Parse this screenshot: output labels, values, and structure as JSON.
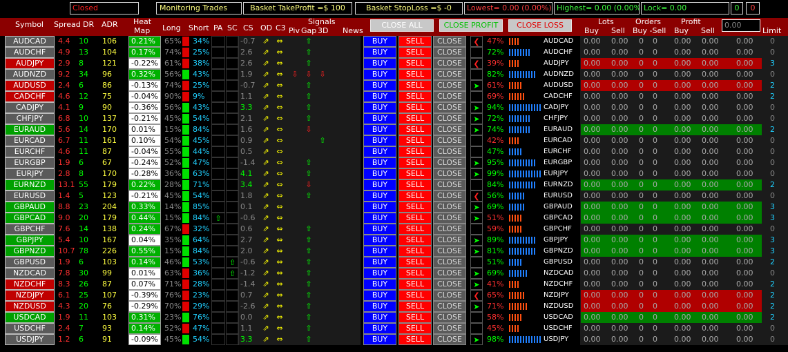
{
  "topbar": {
    "status": "Closed",
    "monitoring": "Monitoring Trades",
    "basket_tp": "Basket TakeProfit =$ 100",
    "basket_sl": "Basket StopLoss =$ -0",
    "lowest": "Lowest= 0.00 (0.00%)",
    "highest": "Highest= 0.00 (0.00%)",
    "lock": "Lock= 0.00",
    "c1": "0",
    "c2": "0"
  },
  "header": {
    "symbol": "Symbol",
    "spread": "Spread",
    "dr": "DR",
    "adr": "ADR",
    "heat": "Heat",
    "map": "Map",
    "long": "Long",
    "short": "Short",
    "pa": "PA",
    "sc": "SC",
    "cs": "CS",
    "od": "OD",
    "c3": "C3",
    "signals": "Signals",
    "piv": "Piv",
    "gap": "Gap",
    "three_d": "3D",
    "news": "News",
    "close_all": "CLOSE ALL",
    "close_profit": "CLOSE PROFIT",
    "close_loss": "CLOSE LOSS",
    "lots": "Lots",
    "orders": "Orders",
    "profit": "Profit",
    "buy": "Buy",
    "sell": "Sell",
    "buy_sell": "Buy -Sell",
    "input_value": "0.00",
    "limit": "Limit"
  },
  "labels": {
    "buy": "BUY",
    "sell": "SELL",
    "close": "CLOSE"
  },
  "colors": {
    "green": "#00a000",
    "red": "#c00000",
    "grey": "#5a5a5a",
    "blue": "#0000ff"
  },
  "rows": [
    {
      "sym": "AUDCAD",
      "bg": "grey",
      "sp": "4.4",
      "dr": "10",
      "adr": "106",
      "heat": "0.21%",
      "hp": true,
      "long": "65%",
      "short": "34%",
      "lc": "r",
      "cs": "-0.7",
      "csc": "grey",
      "sig": [
        1,
        2,
        0,
        3,
        0
      ],
      "sigc": 1,
      "pct": "47%",
      "pctc": "r",
      "pair": "AUDCAD",
      "lim": "0",
      "lc2": "grey",
      "arrow": "<",
      "arrc": "r",
      "bars": [
        0,
        0,
        0,
        0
      ],
      "rbg": ""
    },
    {
      "sym": "AUDCHF",
      "bg": "grey",
      "sp": "4.9",
      "dr": "13",
      "adr": "104",
      "heat": "0.17%",
      "hp": true,
      "long": "74%",
      "short": "25%",
      "lc": "r",
      "cs": "2.6",
      "csc": "grey",
      "sig": [
        1,
        2,
        0,
        3,
        0
      ],
      "pct": "72%",
      "pctc": "g",
      "pair": "AUDCHF",
      "lim": "0",
      "lc2": "grey",
      "arrow": "",
      "bars": [
        1,
        1,
        1,
        1,
        1,
        1,
        1,
        1
      ],
      "rbg": ""
    },
    {
      "sym": "AUDJPY",
      "bg": "red",
      "sp": "2.9",
      "dr": "8",
      "adr": "121",
      "heat": "-0.22%",
      "hp": false,
      "long": "61%",
      "short": "38%",
      "lc": "r",
      "cs": "2.6",
      "csc": "grey",
      "sig": [
        1,
        2,
        0,
        3,
        0
      ],
      "pct": "39%",
      "pctc": "r",
      "pair": "AUDJPY",
      "lim": "3",
      "lc2": "c",
      "arrow": "<",
      "arrc": "r",
      "bars": [
        0,
        0,
        0,
        0
      ],
      "rbg": "red"
    },
    {
      "sym": "AUDNZD",
      "bg": "grey",
      "sp": "9.2",
      "dr": "34",
      "adr": "96",
      "heat": "0.32%",
      "hp": true,
      "long": "56%",
      "short": "43%",
      "lc": "g",
      "cs": "1.9",
      "csc": "grey",
      "sig": [
        1,
        2,
        4,
        4,
        4
      ],
      "pct": "82%",
      "pctc": "g",
      "pair": "AUDNZD",
      "lim": "0",
      "lc2": "grey",
      "arrow": "",
      "bars": [
        1,
        1,
        1,
        1,
        1,
        1,
        1,
        1,
        1,
        1
      ],
      "rbg": ""
    },
    {
      "sym": "AUDUSD",
      "bg": "red",
      "sp": "2.4",
      "dr": "6",
      "adr": "86",
      "heat": "-0.13%",
      "hp": false,
      "long": "74%",
      "short": "25%",
      "lc": "r",
      "cs": "-0.7",
      "csc": "grey",
      "sig": [
        1,
        2,
        0,
        3,
        0
      ],
      "pct": "61%",
      "pctc": "r",
      "pair": "AUDUSD",
      "lim": "2",
      "lc2": "c",
      "arrow": ">",
      "arrc": "g",
      "bars": [
        0,
        0,
        0,
        0,
        0
      ],
      "rbg": "red"
    },
    {
      "sym": "CADCHF",
      "bg": "red",
      "sp": "4.6",
      "dr": "12",
      "adr": "75",
      "heat": "-0.04%",
      "hp": false,
      "long": "90%",
      "short": "9%",
      "lc": "r",
      "cs": "1.1",
      "csc": "grey",
      "sig": [
        1,
        2,
        0,
        3,
        0
      ],
      "pct": "69%",
      "pctc": "r",
      "pair": "CADCHF",
      "lim": "2",
      "lc2": "c",
      "arrow": "",
      "bars": [
        0,
        0,
        0,
        0,
        0,
        0
      ],
      "rbg": ""
    },
    {
      "sym": "CADJPY",
      "bg": "grey",
      "sp": "4.1",
      "dr": "9",
      "adr": "90",
      "heat": "-0.36%",
      "hp": false,
      "long": "56%",
      "short": "43%",
      "lc": "g",
      "cs": "3.3",
      "csc": "g",
      "sig": [
        1,
        2,
        0,
        3,
        0
      ],
      "pct": "94%",
      "pctc": "g",
      "pair": "CADJPY",
      "lim": "0",
      "lc2": "grey",
      "arrow": ">",
      "arrc": "g",
      "bars": [
        1,
        1,
        1,
        1,
        1,
        1,
        1,
        1,
        1,
        1,
        1,
        1
      ],
      "rbg": ""
    },
    {
      "sym": "CHFJPY",
      "bg": "grey",
      "sp": "6.8",
      "dr": "10",
      "adr": "137",
      "heat": "-0.21%",
      "hp": false,
      "long": "45%",
      "short": "54%",
      "lc": "g",
      "cs": "2.1",
      "csc": "grey",
      "sig": [
        1,
        2,
        0,
        3,
        0
      ],
      "pct": "72%",
      "pctc": "g",
      "pair": "CHFJPY",
      "lim": "0",
      "lc2": "grey",
      "arrow": ">",
      "arrc": "g",
      "bars": [
        1,
        1,
        1,
        1,
        1,
        1,
        1,
        1
      ],
      "rbg": ""
    },
    {
      "sym": "EURAUD",
      "bg": "green",
      "sp": "5.6",
      "dr": "14",
      "adr": "170",
      "heat": "0.01%",
      "hp": false,
      "long": "15%",
      "short": "84%",
      "lc": "g",
      "cs": "1.6",
      "csc": "grey",
      "sig": [
        1,
        2,
        0,
        4,
        0
      ],
      "pct": "74%",
      "pctc": "g",
      "pair": "EURAUD",
      "lim": "2",
      "lc2": "c",
      "arrow": ">",
      "arrc": "g",
      "bars": [
        1,
        1,
        1,
        1,
        1,
        1,
        1,
        1
      ],
      "rbg": "green"
    },
    {
      "sym": "EURCAD",
      "bg": "grey",
      "sp": "6.7",
      "dr": "11",
      "adr": "161",
      "heat": "0.10%",
      "hp": false,
      "long": "54%",
      "short": "45%",
      "lc": "g",
      "cs": "0.9",
      "csc": "grey",
      "sig": [
        1,
        2,
        0,
        0,
        3
      ],
      "pct": "42%",
      "pctc": "r",
      "pair": "EURCAD",
      "lim": "0",
      "lc2": "grey",
      "arrow": "",
      "bars": [
        0,
        0,
        0,
        0
      ],
      "rbg": ""
    },
    {
      "sym": "EURCHF",
      "bg": "grey",
      "sp": "4.6",
      "dr": "11",
      "adr": "87",
      "heat": "-0.04%",
      "hp": false,
      "long": "55%",
      "short": "44%",
      "lc": "g",
      "cs": "0.5",
      "csc": "grey",
      "sig": [
        1,
        2,
        0,
        0,
        0
      ],
      "pct": "47%",
      "pctc": "g",
      "pair": "EURCHF",
      "lim": "0",
      "lc2": "grey",
      "arrow": "",
      "bars": [
        1,
        1,
        1,
        1,
        1
      ],
      "rbg": ""
    },
    {
      "sym": "EURGBP",
      "bg": "grey",
      "sp": "1.9",
      "dr": "6",
      "adr": "67",
      "heat": "-0.24%",
      "hp": false,
      "long": "52%",
      "short": "47%",
      "lc": "g",
      "cs": "-1.4",
      "csc": "grey",
      "sig": [
        1,
        2,
        0,
        3,
        0
      ],
      "pct": "95%",
      "pctc": "g",
      "pair": "EURGBP",
      "lim": "0",
      "lc2": "grey",
      "arrow": ">",
      "arrc": "g",
      "bars": [
        1,
        1,
        1,
        1,
        1,
        1,
        1,
        1,
        1,
        1
      ],
      "rbg": ""
    },
    {
      "sym": "EURJPY",
      "bg": "grey",
      "sp": "2.8",
      "dr": "8",
      "adr": "170",
      "heat": "-0.28%",
      "hp": false,
      "long": "36%",
      "short": "63%",
      "lc": "g",
      "cs": "4.1",
      "csc": "g",
      "sig": [
        1,
        2,
        0,
        3,
        0
      ],
      "pct": "99%",
      "pctc": "g",
      "pair": "EURJPY",
      "lim": "0",
      "lc2": "grey",
      "arrow": ">",
      "arrc": "g",
      "bars": [
        1,
        1,
        1,
        1,
        1,
        1,
        1,
        1,
        1,
        1,
        1,
        1,
        1
      ],
      "rbg": ""
    },
    {
      "sym": "EURNZD",
      "bg": "green",
      "sp": "13.1",
      "dr": "55",
      "adr": "179",
      "heat": "0.22%",
      "hp": true,
      "long": "28%",
      "short": "71%",
      "lc": "g",
      "cs": "3.4",
      "csc": "g",
      "sig": [
        1,
        2,
        0,
        4,
        0
      ],
      "pct": "84%",
      "pctc": "g",
      "pair": "EURNZD",
      "lim": "2",
      "lc2": "c",
      "arrow": "",
      "bars": [
        1,
        1,
        1,
        1,
        1,
        1,
        1,
        1,
        1,
        1
      ],
      "rbg": "green"
    },
    {
      "sym": "EURUSD",
      "bg": "grey",
      "sp": "1.4",
      "dr": "5",
      "adr": "123",
      "heat": "-0.21%",
      "hp": false,
      "long": "45%",
      "short": "54%",
      "lc": "g",
      "cs": "1.8",
      "csc": "grey",
      "sig": [
        1,
        2,
        0,
        3,
        0
      ],
      "pct": "56%",
      "pctc": "g",
      "pair": "EURUSD",
      "lim": "0",
      "lc2": "grey",
      "arrow": "<",
      "arrc": "r",
      "bars": [
        1,
        1,
        1,
        1,
        1,
        1
      ],
      "rbg": ""
    },
    {
      "sym": "GBPAUD",
      "bg": "green",
      "sp": "8.8",
      "dr": "23",
      "adr": "204",
      "heat": "0.33%",
      "hp": true,
      "long": "14%",
      "short": "85%",
      "lc": "g",
      "cs": "0.1",
      "csc": "grey",
      "sig": [
        1,
        2,
        0,
        0,
        0
      ],
      "pct": "69%",
      "pctc": "g",
      "pair": "GBPAUD",
      "lim": "3",
      "lc2": "c",
      "arrow": ">",
      "arrc": "g",
      "bars": [
        1,
        1,
        1,
        1,
        1,
        1
      ],
      "rbg": "green"
    },
    {
      "sym": "GBPCAD",
      "bg": "green",
      "sp": "9.0",
      "dr": "20",
      "adr": "179",
      "heat": "0.44%",
      "hp": true,
      "long": "15%",
      "short": "84%",
      "lc": "g",
      "cs": "-0.6",
      "csc": "grey",
      "sig": [
        1,
        2,
        0,
        0,
        0
      ],
      "pa": true,
      "pct": "51%",
      "pctc": "r",
      "pair": "GBPCAD",
      "lim": "3",
      "lc2": "c",
      "arrow": ">",
      "arrc": "g",
      "bars": [
        0,
        0,
        0,
        0,
        0
      ],
      "rbg": "green"
    },
    {
      "sym": "GBPCHF",
      "bg": "grey",
      "sp": "7.6",
      "dr": "14",
      "adr": "138",
      "heat": "0.24%",
      "hp": true,
      "long": "67%",
      "short": "32%",
      "lc": "r",
      "cs": "0.6",
      "csc": "grey",
      "sig": [
        1,
        2,
        0,
        3,
        0
      ],
      "pct": "59%",
      "pctc": "r",
      "pair": "GBPCHF",
      "lim": "0",
      "lc2": "grey",
      "arrow": "",
      "bars": [
        0,
        0,
        0,
        0,
        0
      ],
      "rbg": ""
    },
    {
      "sym": "GBPJPY",
      "bg": "green",
      "sp": "5.4",
      "dr": "10",
      "adr": "167",
      "heat": "0.04%",
      "hp": false,
      "long": "35%",
      "short": "64%",
      "lc": "g",
      "cs": "2.7",
      "csc": "grey",
      "sig": [
        1,
        2,
        0,
        3,
        0
      ],
      "pct": "89%",
      "pctc": "g",
      "pair": "GBPJPY",
      "lim": "3",
      "lc2": "c",
      "arrow": ">",
      "arrc": "g",
      "bars": [
        1,
        1,
        1,
        1,
        1,
        1,
        1,
        1,
        1,
        1
      ],
      "rbg": "green"
    },
    {
      "sym": "GBPNZD",
      "bg": "green",
      "sp": "10.7",
      "dr": "78",
      "adr": "226",
      "heat": "0.55%",
      "hp": true,
      "long": "15%",
      "short": "84%",
      "lc": "g",
      "cs": "2.0",
      "csc": "grey",
      "sig": [
        1,
        2,
        0,
        3,
        0
      ],
      "pct": "81%",
      "pctc": "g",
      "pair": "GBPNZD",
      "lim": "3",
      "lc2": "c",
      "arrow": ">",
      "arrc": "g",
      "bars": [
        1,
        1,
        1,
        1,
        1,
        1,
        1,
        1,
        1,
        1
      ],
      "rbg": "green"
    },
    {
      "sym": "GBPUSD",
      "bg": "grey",
      "sp": "1.9",
      "dr": "6",
      "adr": "103",
      "heat": "0.14%",
      "hp": true,
      "long": "46%",
      "short": "53%",
      "lc": "g",
      "cs": "-0.6",
      "csc": "grey",
      "sig": [
        1,
        2,
        0,
        3,
        0
      ],
      "sc": true,
      "pct": "51%",
      "pctc": "g",
      "pair": "GBPUSD",
      "lim": "2",
      "lc2": "c",
      "arrow": "",
      "bars": [
        1,
        1,
        1,
        1,
        1
      ],
      "rbg": ""
    },
    {
      "sym": "NZDCAD",
      "bg": "grey",
      "sp": "7.8",
      "dr": "30",
      "adr": "99",
      "heat": "0.01%",
      "hp": false,
      "long": "63%",
      "short": "36%",
      "lc": "r",
      "cs": "-1.2",
      "csc": "grey",
      "sig": [
        1,
        2,
        0,
        3,
        0
      ],
      "sc": true,
      "pct": "69%",
      "pctc": "g",
      "pair": "NZDCAD",
      "lim": "0",
      "lc2": "grey",
      "arrow": ">",
      "arrc": "g",
      "bars": [
        1,
        1,
        1,
        1,
        1,
        1,
        1
      ],
      "rbg": ""
    },
    {
      "sym": "NZDCHF",
      "bg": "red",
      "sp": "8.3",
      "dr": "26",
      "adr": "87",
      "heat": "0.07%",
      "hp": false,
      "long": "71%",
      "short": "28%",
      "lc": "r",
      "cs": "-1.4",
      "csc": "grey",
      "sig": [
        1,
        2,
        0,
        3,
        0
      ],
      "pct": "41%",
      "pctc": "r",
      "pair": "NZDCHF",
      "lim": "2",
      "lc2": "c",
      "arrow": ">",
      "arrc": "g",
      "bars": [
        0,
        0,
        0,
        0
      ],
      "rbg": ""
    },
    {
      "sym": "NZDJPY",
      "bg": "red",
      "sp": "6.1",
      "dr": "25",
      "adr": "107",
      "heat": "-0.39%",
      "hp": false,
      "long": "76%",
      "short": "23%",
      "lc": "r",
      "cs": "0.7",
      "csc": "grey",
      "sig": [
        1,
        2,
        0,
        3,
        0
      ],
      "pct": "65%",
      "pctc": "r",
      "pair": "NZDJPY",
      "lim": "2",
      "lc2": "c",
      "arrow": "<",
      "arrc": "r",
      "bars": [
        0,
        0,
        0,
        0,
        0,
        0
      ],
      "rbg": "red"
    },
    {
      "sym": "NZDUSD",
      "bg": "red",
      "sp": "4.3",
      "dr": "20",
      "adr": "76",
      "heat": "-0.29%",
      "hp": false,
      "long": "70%",
      "short": "29%",
      "lc": "r",
      "cs": "-2.6",
      "csc": "grey",
      "sig": [
        1,
        2,
        0,
        3,
        0
      ],
      "pct": "71%",
      "pctc": "r",
      "pair": "NZDUSD",
      "lim": "2",
      "lc2": "c",
      "arrow": ">",
      "arrc": "g",
      "bars": [
        0,
        0,
        0,
        0,
        0,
        0,
        0
      ],
      "rbg": "red"
    },
    {
      "sym": "USDCAD",
      "bg": "green",
      "sp": "1.9",
      "dr": "11",
      "adr": "103",
      "heat": "0.31%",
      "hp": true,
      "long": "23%",
      "short": "76%",
      "lc": "g",
      "cs": "0.0",
      "csc": "grey",
      "sig": [
        1,
        2,
        0,
        3,
        0
      ],
      "pct": "58%",
      "pctc": "r",
      "pair": "USDCAD",
      "lim": "2",
      "lc2": "c",
      "arrow": "",
      "bars": [
        0,
        0,
        0,
        0,
        0
      ],
      "rbg": "green"
    },
    {
      "sym": "USDCHF",
      "bg": "grey",
      "sp": "2.4",
      "dr": "7",
      "adr": "93",
      "heat": "0.14%",
      "hp": true,
      "long": "52%",
      "short": "47%",
      "lc": "r",
      "cs": "1.1",
      "csc": "grey",
      "sig": [
        1,
        2,
        0,
        3,
        0
      ],
      "pct": "45%",
      "pctc": "r",
      "pair": "USDCHF",
      "lim": "0",
      "lc2": "grey",
      "arrow": "",
      "bars": [
        0,
        0,
        0,
        0
      ],
      "rbg": ""
    },
    {
      "sym": "USDJPY",
      "bg": "grey",
      "sp": "1.2",
      "dr": "6",
      "adr": "91",
      "heat": "-0.09%",
      "hp": false,
      "long": "45%",
      "short": "54%",
      "lc": "g",
      "cs": "3.3",
      "csc": "g",
      "sig": [
        1,
        2,
        0,
        3,
        0
      ],
      "pct": "98%",
      "pctc": "g",
      "pair": "USDJPY",
      "lim": "0",
      "lc2": "grey",
      "arrow": ">",
      "arrc": "g",
      "bars": [
        1,
        1,
        1,
        1,
        1,
        1,
        1,
        1,
        1,
        1,
        1,
        1,
        1
      ],
      "rbg": ""
    }
  ],
  "zeros": {
    "lots": "0.00",
    "count": "0"
  },
  "glyphs": {
    "up": "⇧",
    "down": "⇩",
    "dual": "⇔",
    "updown": "⇕",
    "diag": "⇗",
    "gt": "➤",
    "lt": "❮"
  }
}
